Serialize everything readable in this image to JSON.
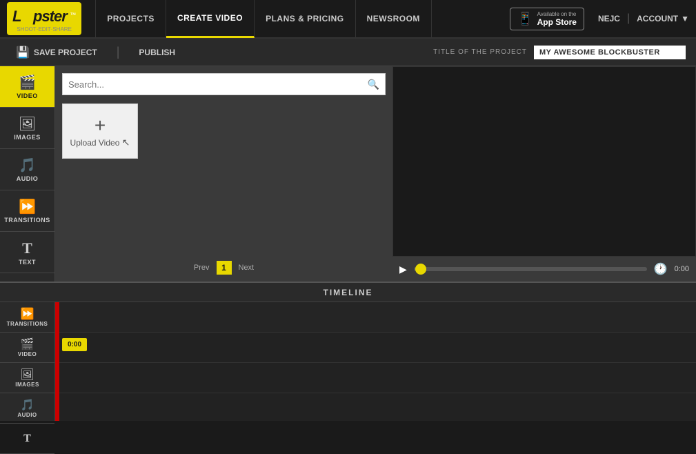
{
  "nav": {
    "logo_text": "L∞pster",
    "logo_tm": "™",
    "logo_tagline": "SHOOT·EDIT·SHARE",
    "links": [
      {
        "label": "PROJECTS",
        "active": false
      },
      {
        "label": "CREATE VIDEO",
        "active": true
      },
      {
        "label": "PLANS & PRICING",
        "active": false
      },
      {
        "label": "NEWSROOM",
        "active": false
      }
    ],
    "app_store_top": "Available on the",
    "app_store_bottom": "App Store",
    "user_name": "NEJC",
    "account_label": "ACCOUNT"
  },
  "toolbar": {
    "save_label": "SAVE PROJECT",
    "publish_label": "PUBLISH",
    "project_title_label": "TITLE OF THE PROJECT",
    "project_title_value": "MY AWESOME BLOCKBUSTER"
  },
  "sidebar": {
    "items": [
      {
        "id": "video",
        "label": "VIDEO",
        "icon": "🎬",
        "active": true
      },
      {
        "id": "images",
        "label": "IMAGES",
        "icon": "🖼",
        "active": false
      },
      {
        "id": "audio",
        "label": "AUDIO",
        "icon": "🎵",
        "active": false
      },
      {
        "id": "transitions",
        "label": "TRANSITIONS",
        "icon": "⏩",
        "active": false
      },
      {
        "id": "text",
        "label": "TEXT",
        "icon": "T",
        "active": false
      }
    ]
  },
  "content": {
    "search_placeholder": "Search...",
    "upload_label": "Upload Video",
    "pagination": {
      "prev": "Prev",
      "page": "1",
      "next": "Next"
    }
  },
  "preview": {
    "time": "0:00"
  },
  "timeline": {
    "label": "TIMELINE",
    "tracks": [
      {
        "id": "transitions",
        "icon": "⏩",
        "label": "TRANSITIONS"
      },
      {
        "id": "video",
        "icon": "🎬",
        "label": "VIDEO"
      },
      {
        "id": "images",
        "icon": "🖼",
        "label": "IMAGES"
      },
      {
        "id": "audio",
        "icon": "🎵",
        "label": "AUDIO"
      },
      {
        "id": "text",
        "icon": "T",
        "label": ""
      }
    ],
    "time_block": "0:00"
  }
}
